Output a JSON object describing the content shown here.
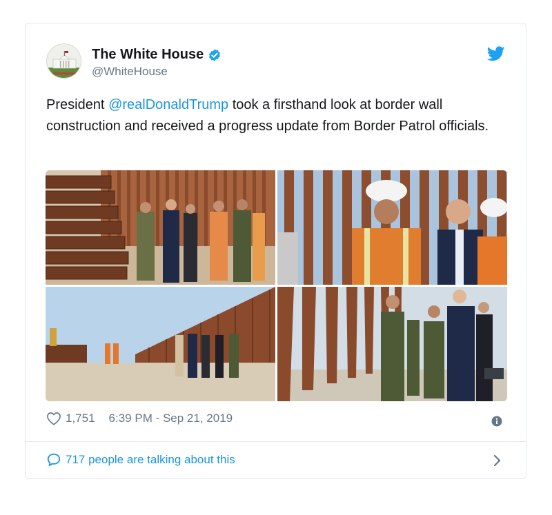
{
  "account": {
    "name": "The White House",
    "handle": "@WhiteHouse"
  },
  "tweet": {
    "text_before": "President ",
    "mention": "@realDonaldTrump",
    "text_after": " took a firsthand look at border wall construction and received a progress update from Border Patrol officials."
  },
  "stats": {
    "likes": "1,751",
    "timestamp": "6:39 PM - Sep 21, 2019"
  },
  "footer": {
    "talking": "717 people are talking about this"
  },
  "icons": {
    "verified": "verified-badge-icon",
    "brand": "twitter-bird-icon",
    "like": "heart-icon",
    "info": "info-icon",
    "reply": "speech-bubble-icon",
    "more": "chevron-right-icon"
  },
  "colors": {
    "link": "#1b95e0",
    "secondary_text": "#657786",
    "border": "#e1e8ed"
  }
}
